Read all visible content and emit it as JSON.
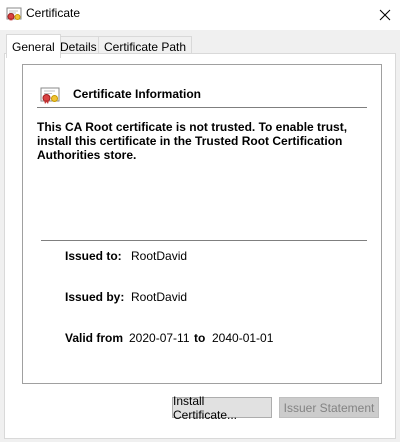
{
  "window": {
    "title": "Certificate",
    "close_icon": "close-icon",
    "icon": "certificate-icon"
  },
  "tabs": [
    {
      "label": "General",
      "active": true
    },
    {
      "label": "Details",
      "active": false
    },
    {
      "label": "Certificate Path",
      "active": false
    }
  ],
  "general": {
    "header": "Certificate Information",
    "warning": "This CA Root certificate is not trusted. To enable trust, install this certificate in the Trusted Root Certification Authorities store.",
    "issued_to_label": "Issued to:",
    "issued_to_value": "RootDavid",
    "issued_by_label": "Issued by:",
    "issued_by_value": "RootDavid",
    "valid_from_label": "Valid from",
    "valid_from_value": "2020-07-11",
    "to_label": "to",
    "valid_to_value": "2040-01-01"
  },
  "buttons": {
    "install": "Install Certificate...",
    "issuer_statement": "Issuer Statement"
  },
  "colors": {
    "panel_bg": "#ffffff",
    "dialog_bg": "#f0f0f0",
    "button_bg": "#e1e1e1",
    "disabled_text": "#838383"
  }
}
